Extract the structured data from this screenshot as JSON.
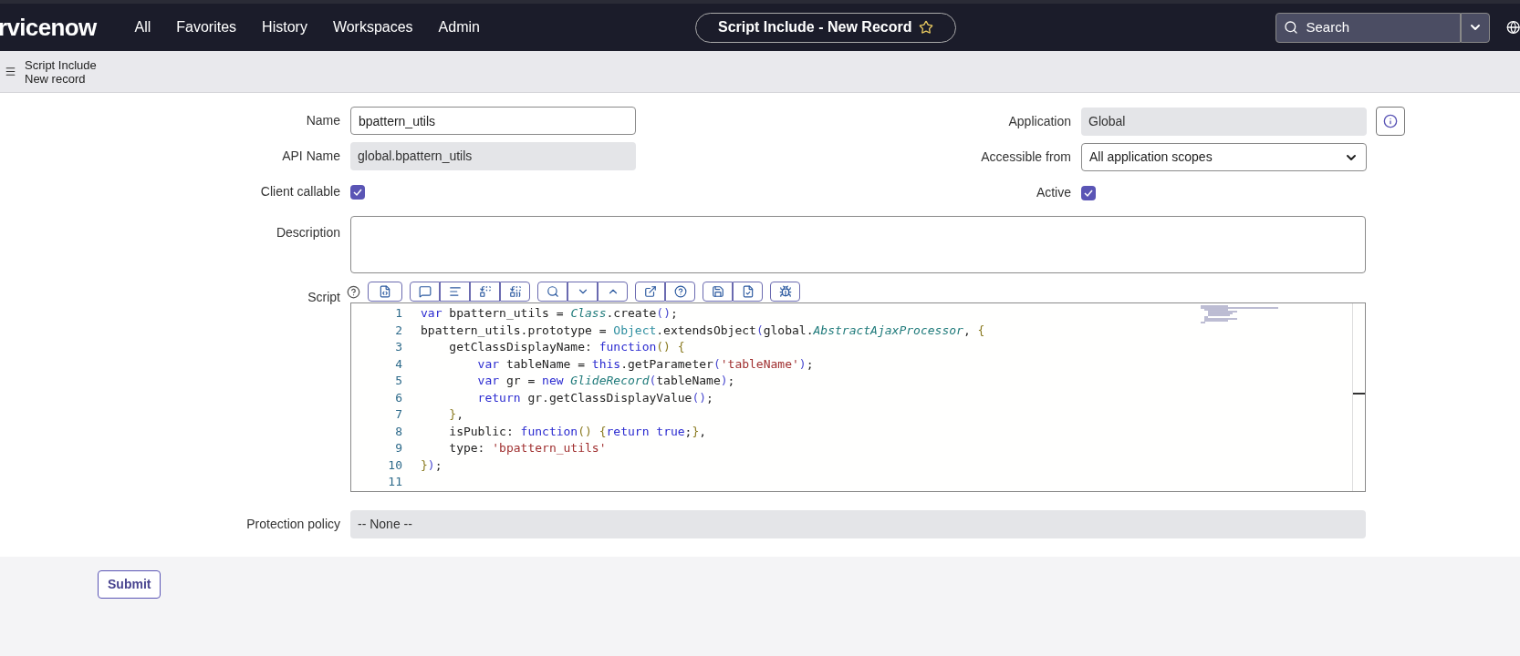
{
  "top_bar": {
    "logo": "rvicenow",
    "nav": [
      "All",
      "Favorites",
      "History",
      "Workspaces",
      "Admin"
    ],
    "record_title": "Script Include - New Record",
    "search": {
      "placeholder": "Search"
    }
  },
  "header": {
    "title": "Script Include",
    "subtitle": "New record"
  },
  "form": {
    "left": [
      {
        "kind": "input",
        "label": "Name",
        "value": "bpattern_utils"
      },
      {
        "kind": "readonly",
        "label": "API Name",
        "value": "global.bpattern_utils"
      },
      {
        "kind": "checkbox",
        "label": "Client callable",
        "checked": true
      }
    ],
    "right": [
      {
        "kind": "readonly",
        "label": "Application",
        "value": "Global"
      },
      {
        "kind": "select",
        "label": "Accessible from",
        "value": "All application scopes"
      },
      {
        "kind": "checkbox",
        "label": "Active",
        "checked": true
      }
    ],
    "description": {
      "label": "Description"
    },
    "script": {
      "label": "Script",
      "lines": [
        {
          "number": "1",
          "tokens": [
            {
              "kind": "kw",
              "text": "var"
            },
            {
              "kind": "plain",
              "text": " bpattern_utils = "
            },
            {
              "kind": "cls",
              "text": "Class"
            },
            {
              "kind": "plain",
              "text": ".create"
            },
            {
              "kind": "br",
              "text": "()"
            },
            {
              "kind": "plain",
              "text": ";"
            }
          ]
        },
        {
          "number": "2",
          "tokens": [
            {
              "kind": "plain",
              "text": "bpattern_utils.prototype = "
            },
            {
              "kind": "obj",
              "text": "Object"
            },
            {
              "kind": "plain",
              "text": ".extendsObject"
            },
            {
              "kind": "br",
              "text": "("
            },
            {
              "kind": "plain",
              "text": "global."
            },
            {
              "kind": "cls",
              "text": "AbstractAjaxProcessor"
            },
            {
              "kind": "plain",
              "text": ", "
            },
            {
              "kind": "br2",
              "text": "{"
            }
          ]
        },
        {
          "number": "3",
          "tokens": [
            {
              "kind": "plain",
              "text": "    getClassDisplayName: "
            },
            {
              "kind": "kw",
              "text": "function"
            },
            {
              "kind": "br2",
              "text": "() {"
            }
          ]
        },
        {
          "number": "4",
          "tokens": [
            {
              "kind": "kw",
              "text": "        var"
            },
            {
              "kind": "plain",
              "text": " tableName = "
            },
            {
              "kind": "kw",
              "text": "this"
            },
            {
              "kind": "plain",
              "text": ".getParameter"
            },
            {
              "kind": "br",
              "text": "("
            },
            {
              "kind": "str",
              "text": "'tableName'"
            },
            {
              "kind": "br",
              "text": ")"
            },
            {
              "kind": "plain",
              "text": ";"
            }
          ]
        },
        {
          "number": "5",
          "tokens": [
            {
              "kind": "kw",
              "text": "        var"
            },
            {
              "kind": "plain",
              "text": " gr = "
            },
            {
              "kind": "kw",
              "text": "new"
            },
            {
              "kind": "cls",
              "text": " GlideRecord"
            },
            {
              "kind": "br",
              "text": "("
            },
            {
              "kind": "plain",
              "text": "tableName"
            },
            {
              "kind": "br",
              "text": ")"
            },
            {
              "kind": "plain",
              "text": ";"
            }
          ]
        },
        {
          "number": "6",
          "tokens": [
            {
              "kind": "kw",
              "text": "        return"
            },
            {
              "kind": "plain",
              "text": " gr.getClassDisplayValue"
            },
            {
              "kind": "br",
              "text": "()"
            },
            {
              "kind": "plain",
              "text": ";"
            }
          ]
        },
        {
          "number": "7",
          "tokens": [
            {
              "kind": "br2",
              "text": "    }"
            },
            {
              "kind": "plain",
              "text": ","
            }
          ]
        },
        {
          "number": "8",
          "tokens": [
            {
              "kind": "plain",
              "text": "    isPublic: "
            },
            {
              "kind": "kw",
              "text": "function"
            },
            {
              "kind": "br2",
              "text": "() {"
            },
            {
              "kind": "kw",
              "text": "return true"
            },
            {
              "kind": "plain",
              "text": ";"
            },
            {
              "kind": "br2",
              "text": "}"
            },
            {
              "kind": "plain",
              "text": ","
            }
          ]
        },
        {
          "number": "9",
          "tokens": [
            {
              "kind": "plain",
              "text": "    type: "
            },
            {
              "kind": "str",
              "text": "'bpattern_utils'"
            }
          ]
        },
        {
          "number": "10",
          "tokens": [
            {
              "kind": "br2",
              "text": "}"
            },
            {
              "kind": "br",
              "text": ")"
            },
            {
              "kind": "plain",
              "text": ";"
            }
          ]
        },
        {
          "number": "11"
        }
      ]
    },
    "protection": {
      "label": "Protection policy",
      "value": "-- None --"
    }
  },
  "submit": "Submit"
}
